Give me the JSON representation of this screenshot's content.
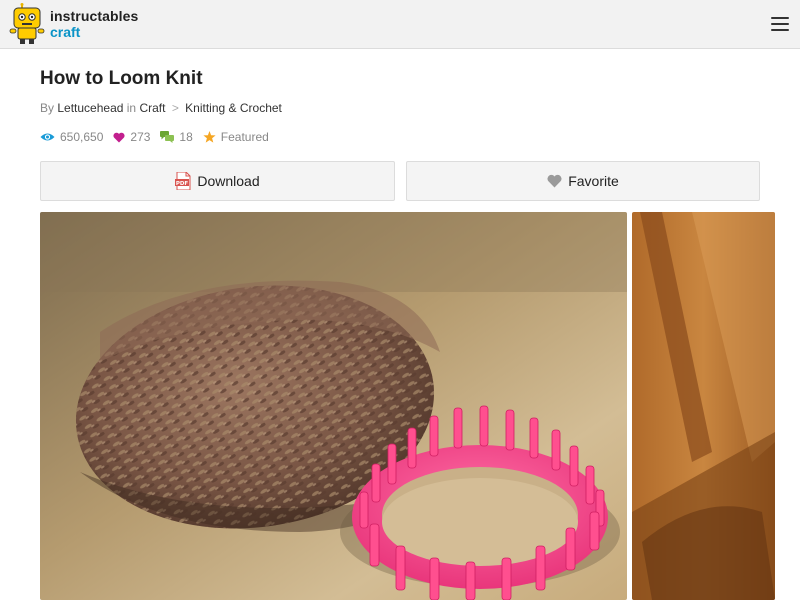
{
  "header": {
    "brand_name": "instructables",
    "channel": "craft",
    "menu_icon": "hamburger-menu-icon",
    "logo_icon": "robot-mascot-icon",
    "colors": {
      "channel": "#0a93c7",
      "bar_bg": "#f2f2f2"
    }
  },
  "article": {
    "title": "How to Loom Knit",
    "byline": {
      "by_prefix": "By",
      "author": "Lettucehead",
      "in_word": "in",
      "category": "Craft",
      "separator": ">",
      "subcategory": "Knitting & Crochet"
    },
    "stats": {
      "views": "650,650",
      "favorites": "273",
      "comments": "18",
      "featured": "Featured",
      "icons": [
        "eye-icon",
        "heart-icon",
        "comment-bubbles-icon",
        "star-icon"
      ],
      "colors": {
        "views": "#1a9bd7",
        "favorites": "#c21f8e",
        "comments": "#6aa633",
        "featured": "#f5a623"
      }
    },
    "actions": {
      "download_label": "Download",
      "favorite_label": "Favorite",
      "download_icon": "pdf-icon",
      "favorite_icon": "heart-icon"
    },
    "gallery": {
      "images": [
        {
          "subject": "yarn-skein-and-pink-round-knitting-loom-photo"
        },
        {
          "subject": "wooden-door-photo"
        }
      ]
    }
  }
}
